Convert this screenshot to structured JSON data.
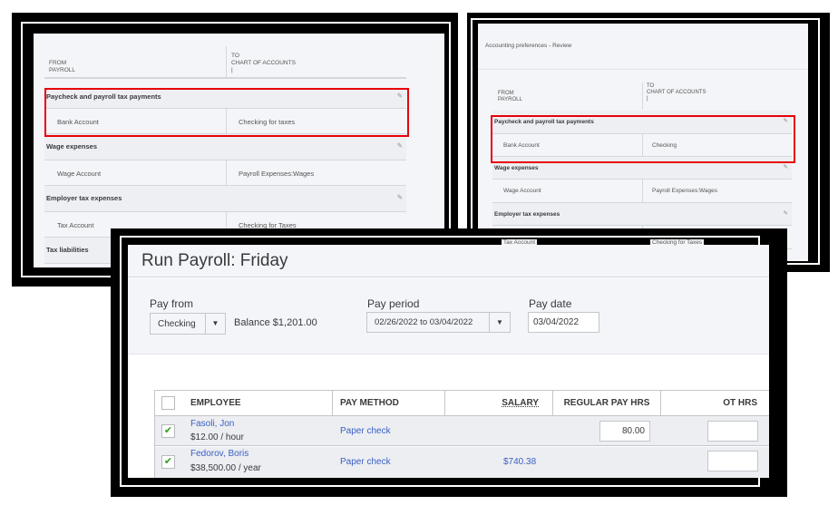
{
  "panel_left": {
    "from_label": [
      "FROM",
      "PAYROLL"
    ],
    "to_label": [
      "TO",
      "CHART OF ACCOUNTS"
    ],
    "sections": [
      {
        "title": "Paycheck and payroll tax payments",
        "from": "Bank Account",
        "to": "Checking for taxes"
      },
      {
        "title": "Wage expenses",
        "from": "Wage Account",
        "to": "Payroll Expenses:Wages"
      },
      {
        "title": "Employer tax expenses",
        "from": "Tax Account",
        "to": "Checking for Taxes"
      },
      {
        "title": "Tax liabilities"
      }
    ]
  },
  "panel_right": {
    "title": "Accounting preferences - Review",
    "from_label": [
      "FROM",
      "PAYROLL"
    ],
    "to_label": [
      "TO",
      "CHART OF ACCOUNTS"
    ],
    "sections": [
      {
        "title": "Paycheck and payroll tax payments",
        "from": "Bank Account",
        "to": "Checking"
      },
      {
        "title": "Wage expenses",
        "from": "Wage Account",
        "to": "Payroll Expenses:Wages"
      },
      {
        "title": "Employer tax expenses",
        "from": "Tax Account",
        "to": "Checking for Taxes"
      }
    ]
  },
  "payroll": {
    "title": "Run Payroll: Friday",
    "pay_from_label": "Pay from",
    "pay_from_value": "Checking",
    "balance": "Balance $1,201.00",
    "pay_period_label": "Pay period",
    "pay_period_value": "02/26/2022 to 03/04/2022",
    "pay_date_label": "Pay date",
    "pay_date_value": "03/04/2022",
    "columns": [
      "EMPLOYEE",
      "PAY METHOD",
      "SALARY",
      "REGULAR PAY HRS",
      "OT HRS"
    ],
    "rows": [
      {
        "name": "Fasoli, Jon",
        "rate": "$12.00 / hour",
        "method": "Paper check",
        "salary": "",
        "regular_hrs": "80.00",
        "checked": true
      },
      {
        "name": "Fedorov, Boris",
        "rate": "$38,500.00 / year",
        "method": "Paper check",
        "salary": "$740.38",
        "regular_hrs": "",
        "checked": true
      }
    ]
  },
  "colors": {
    "highlight": "#e8000b",
    "link": "#3b5fc4",
    "check": "#2ca01c"
  }
}
